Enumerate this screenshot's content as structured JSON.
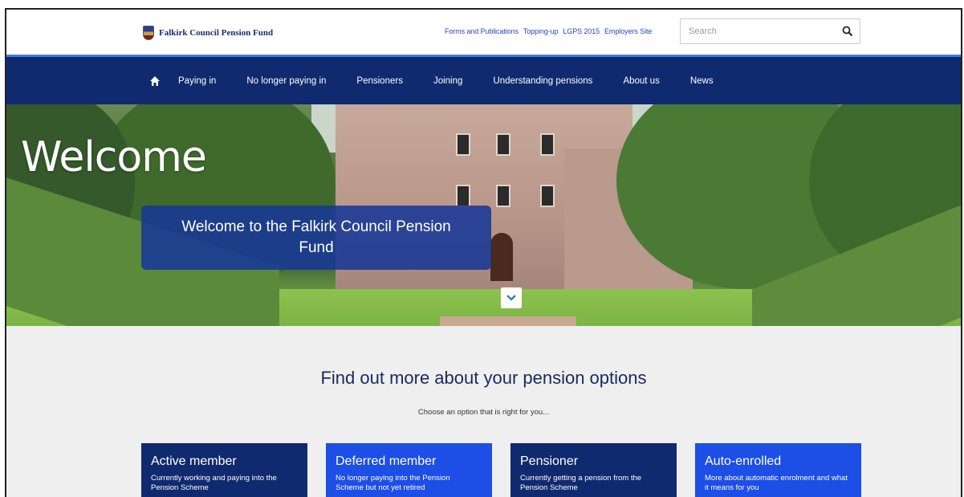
{
  "site": {
    "name": "Falkirk Council Pension Fund"
  },
  "toplinks": [
    "Forms and Publications",
    "Topping-up",
    "LGPS 2015",
    "Employers Site"
  ],
  "search": {
    "placeholder": "Search"
  },
  "nav": {
    "items": [
      "Paying in",
      "No longer paying in",
      "Pensioners",
      "Joining",
      "Understanding pensions",
      "About us",
      "News"
    ]
  },
  "hero": {
    "heading": "Welcome",
    "box_text": "Welcome to the Falkirk Council Pension Fund"
  },
  "options": {
    "title": "Find out more about your pension options",
    "subtitle": "Choose an option that is right for you...",
    "cards": [
      {
        "title": "Active member",
        "desc": "Currently working and paying into the Pension Scheme"
      },
      {
        "title": "Deferred member",
        "desc": "No longer paying into the Pension Scheme but not yet retired"
      },
      {
        "title": "Pensioner",
        "desc": "Currently getting a pension from the Pension Scheme"
      },
      {
        "title": "Auto-enrolled",
        "desc": "More about automatic enrolment and what it means for you"
      }
    ]
  },
  "colors": {
    "nav_bg": "#0f2a6e",
    "accent": "#1d4ee6",
    "link": "#2a45c8"
  }
}
